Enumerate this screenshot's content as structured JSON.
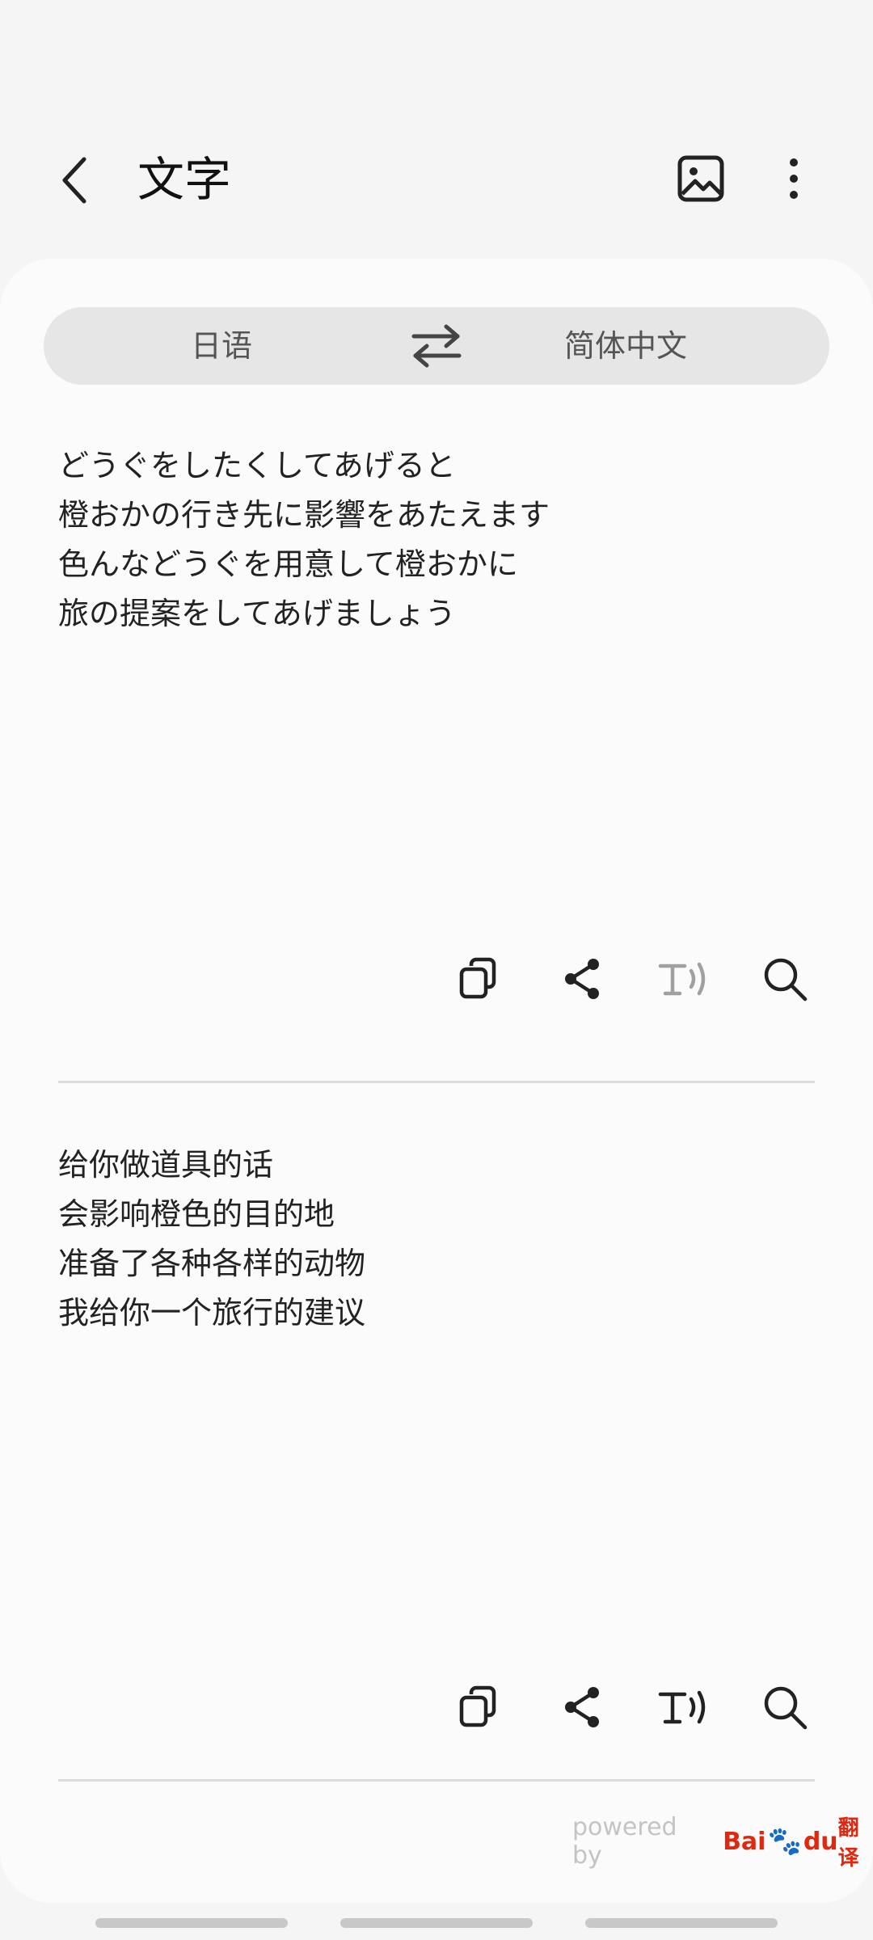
{
  "header": {
    "title": "文字"
  },
  "languages": {
    "source": "日语",
    "target": "简体中文"
  },
  "source_text": {
    "lines": [
      "どうぐをしたくしてあげると",
      "橙おかの行き先に影響をあたえます",
      "色んなどうぐを用意して橙おかに",
      "旅の提案をしてあげましょう"
    ]
  },
  "translated_text": {
    "lines": [
      "给你做道具的话",
      "会影响橙色的目的地",
      "准备了各种各样的动物",
      "我给你一个旅行的建议"
    ]
  },
  "footer": {
    "powered_by": "powered by",
    "brand_bai": "Bai",
    "brand_du": "du",
    "brand_fanyi": "翻译"
  },
  "colors": {
    "background": "#f5f5f5",
    "card": "#fbfbfb",
    "lang_bar": "#e6e6e6",
    "tts_disabled": "#a0a0a0",
    "baidu_red": "#de2910",
    "baidu_blue": "#2932e1"
  },
  "icons": {
    "back": "chevron-left-icon",
    "image": "image-icon",
    "more": "more-vertical-icon",
    "swap": "swap-arrows-icon",
    "copy": "copy-icon",
    "share": "share-icon",
    "tts": "text-to-speech-icon",
    "search": "search-icon"
  }
}
